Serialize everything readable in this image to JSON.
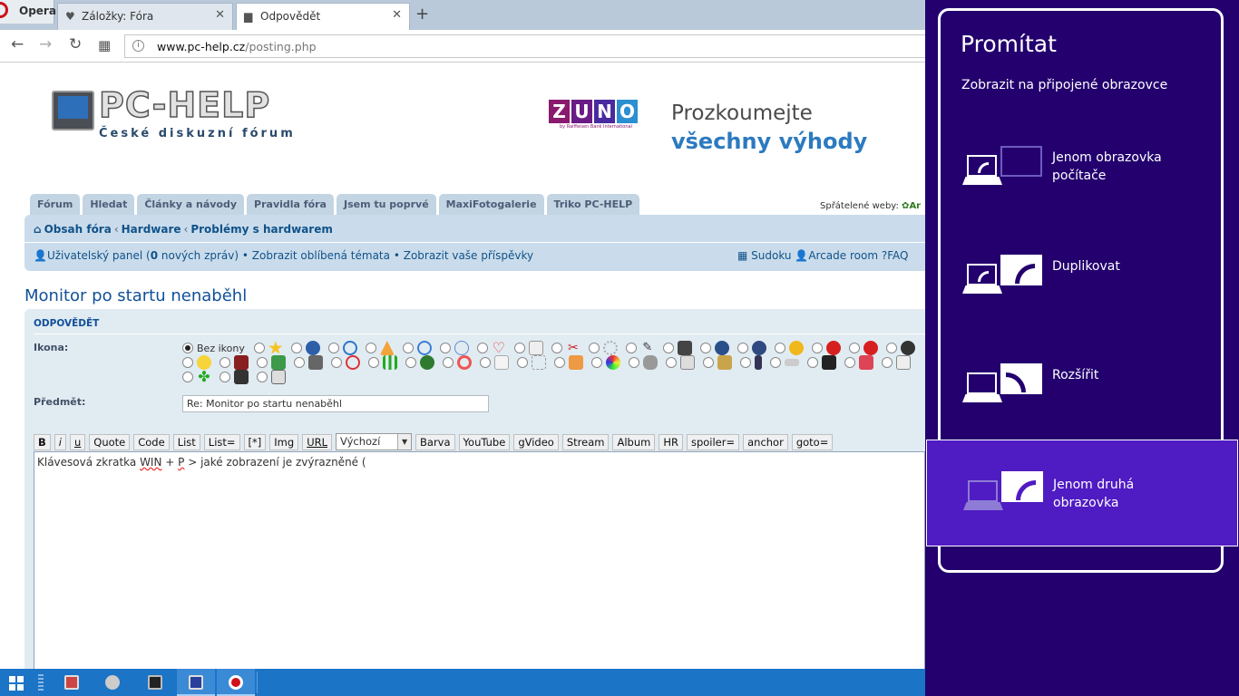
{
  "browser": {
    "menu_label": "Opera",
    "tabs": [
      {
        "label": "Záložky: Fóra"
      },
      {
        "label": "Odpovědět"
      }
    ],
    "url_domain": "www.pc-help.cz",
    "url_path": "/posting.php"
  },
  "site": {
    "logo_title": "PC-HELP",
    "logo_subtitle": "České diskuzní fórum",
    "ad_brand": "ZUNO",
    "ad_brand_sub": "by Raiffeisen Bank International",
    "ad_line1": "Prozkoumejte",
    "ad_line2": "všechny výhody",
    "nav_tabs": [
      "Fórum",
      "Hledat",
      "Články a návody",
      "Pravidla fóra",
      "Jsem tu poprvé",
      "MaxiFotogalerie",
      "Triko PC-HELP"
    ],
    "friends_label": "Spřátelené weby:",
    "friends_link": "Ar"
  },
  "breadcrumb": {
    "items": [
      "Obsah fóra",
      "Hardware",
      "Problémy s hardwarem"
    ]
  },
  "userlinks": {
    "panel_a": "Uživatelský panel (",
    "count": "0",
    "panel_b": " nových zpráv)",
    "fav": "Zobrazit oblíbená témata",
    "posts": "Zobrazit vaše příspěvky",
    "sudoku": "Sudoku",
    "arcade": "Arcade room",
    "faq": "FAQ"
  },
  "post": {
    "topic_title": "Monitor po startu nenaběhl",
    "section_title": "ODPOVĚDĚT",
    "icon_label": "Ikona:",
    "no_icon_label": "Bez ikony",
    "subject_label": "Předmět:",
    "subject_value": "Re: Monitor po startu nenaběhl",
    "body_a": "Klávesová zkratka ",
    "body_win": "WIN",
    "body_b": " + ",
    "body_p": "P",
    "body_c": " > jaké zobrazení je zvýrazněné (",
    "toolbar": [
      "B",
      "i",
      "u",
      "Quote",
      "Code",
      "List",
      "List=",
      "[*]",
      "Img",
      "URL"
    ],
    "size_select": "Výchozí",
    "toolbar2": [
      "Barva",
      "YouTube",
      "gVideo",
      "Stream",
      "Album",
      "HR",
      "spoiler=",
      "anchor",
      "goto="
    ]
  },
  "projection": {
    "title": "Promítat",
    "subtitle": "Zobrazit na připojené obrazovce",
    "options": [
      {
        "line1": "Jenom obrazovka",
        "line2": "počítače"
      },
      {
        "line1": "Duplikovat",
        "line2": ""
      },
      {
        "line1": "Rozšířit",
        "line2": ""
      },
      {
        "line1": "Jenom druhá",
        "line2": "obrazovka"
      }
    ],
    "selected_option": "Jenom druhá obrazovka",
    "accent_color": "#23006e",
    "selected_color": "#4f1bc2"
  },
  "taskbar": {
    "apps": [
      "start-button",
      "photo-app",
      "network-app",
      "camera-app",
      "save-app",
      "opera-app"
    ]
  }
}
